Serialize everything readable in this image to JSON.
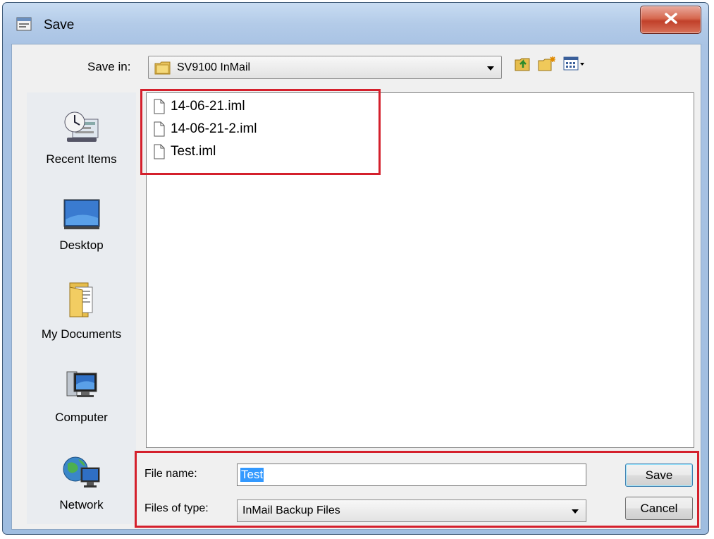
{
  "window": {
    "title": "Save",
    "close_icon": "close-x-icon",
    "accent": "#c1402a"
  },
  "toolbar": {
    "save_in_label": "Save in:",
    "save_in_value": "SV9100 InMail",
    "icons": [
      "up-folder-icon",
      "new-folder-icon",
      "view-menu-icon"
    ]
  },
  "places": [
    {
      "label": "Recent Items",
      "icon": "recent-items-icon"
    },
    {
      "label": "Desktop",
      "icon": "desktop-icon"
    },
    {
      "label": "My Documents",
      "icon": "my-documents-icon"
    },
    {
      "label": "Computer",
      "icon": "computer-icon"
    },
    {
      "label": "Network",
      "icon": "network-icon"
    }
  ],
  "files": [
    {
      "name": "14-06-21.iml",
      "icon": "file-icon"
    },
    {
      "name": "14-06-21-2.iml",
      "icon": "file-icon"
    },
    {
      "name": "Test.iml",
      "icon": "file-icon"
    }
  ],
  "form": {
    "file_name_label": "File name:",
    "file_name_value": "Test",
    "file_type_label": "Files of type:",
    "file_type_value": "InMail Backup Files"
  },
  "buttons": {
    "save": "Save",
    "cancel": "Cancel"
  },
  "highlight_color": "#d4202c"
}
